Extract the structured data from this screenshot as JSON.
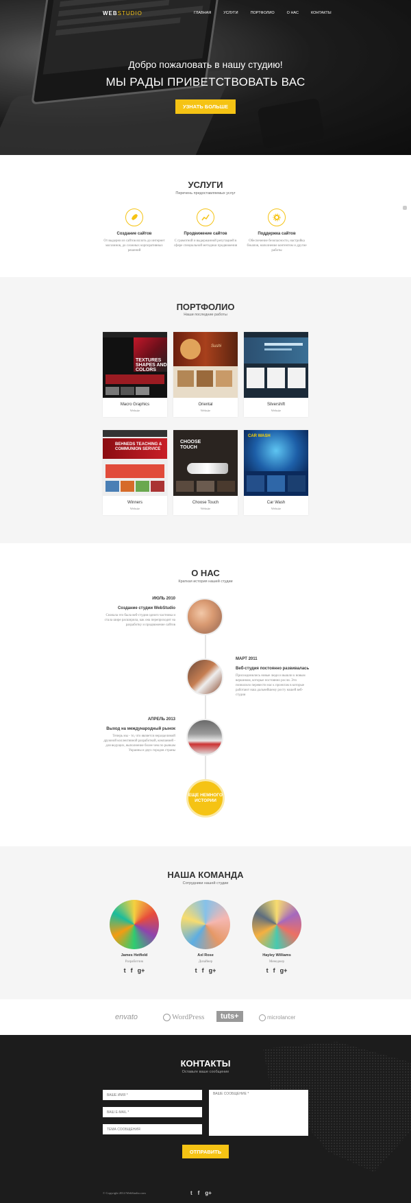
{
  "header": {
    "logo_main": "WEB",
    "logo_accent": "STUDIO",
    "nav": [
      "ГЛАВНАЯ",
      "УСЛУГИ",
      "ПОРТФОЛИО",
      "О НАС",
      "КОНТАКТЫ"
    ],
    "welcome": "Добро пожаловать в нашу студию!",
    "headline": "МЫ РАДЫ ПРИВЕТСТВОВАТЬ ВАС",
    "cta": "УЗНАТЬ БОЛЬШЕ"
  },
  "services": {
    "title": "УСЛУГИ",
    "subtitle": "Перечень предоставляемых услуг",
    "items": [
      {
        "icon": "rocket-icon",
        "title": "Создание сайтов",
        "text": "От выдерни из сайтов вплоть до интернет магазинов, до сложных корпоративных решений"
      },
      {
        "icon": "chart-icon",
        "title": "Продвижение сайтов",
        "text": "С грамотной и выдержанной репутацией в сфере специальной методики продвижения"
      },
      {
        "icon": "gear-icon",
        "title": "Поддержка сайтов",
        "text": "Обеспечение безопасности, настройка бэкапов, наполнение контентом и другие работы"
      }
    ]
  },
  "portfolio": {
    "title": "ПОРТФОЛИО",
    "subtitle": "Наши последние работы",
    "items": [
      {
        "title": "Macro Graphics",
        "sub": "Website"
      },
      {
        "title": "Oriental",
        "sub": "Website"
      },
      {
        "title": "Silvershift",
        "sub": "Website"
      },
      {
        "title": "Winners",
        "sub": "Website"
      },
      {
        "title": "Choose Touch",
        "sub": "Website"
      },
      {
        "title": "Car Wash",
        "sub": "Website"
      }
    ]
  },
  "about": {
    "title": "О НАС",
    "subtitle": "Краткая история нашей студии",
    "events": [
      {
        "date": "ИЮЛЬ 2010",
        "head": "Создание студии WebStudio",
        "body": "Сначала это была веб-студия одного частника и стала шире расширила, как она перепроходит на разработку и продвижение сайтов"
      },
      {
        "date": "МАРТ 2011",
        "head": "Веб-студия постоянно развивалась",
        "body": "Присоединились новые люди и вышли к новым вершинам, которые постоянно росли. Это позволило перевести нас к проектам в которые работают наш дальнейшему росту нашей веб-студии"
      },
      {
        "date": "АПРЕЛЬ 2013",
        "head": "Выход на международный рынок",
        "body": "Теперь мы - то, что является неразделимой дружной коллективной разработкой, компанией - для ведущих, выполнение более чем по рынкам Украины и двух городов страны"
      }
    ],
    "more": "ЕЩЕ НЕМНОГО ИСТОРИИ"
  },
  "team": {
    "title": "НАША КОМАНДА",
    "subtitle": "Сотрудники нашей студии",
    "members": [
      {
        "name": "James Hetfield",
        "role": "Разработчик"
      },
      {
        "name": "Axl Rose",
        "role": "Дизайнер"
      },
      {
        "name": "Hayley Williams",
        "role": "Менеджер"
      }
    ],
    "social": [
      "twitter-icon",
      "facebook-icon",
      "google-plus-icon"
    ]
  },
  "partners": [
    "envato",
    "WordPress",
    "tuts+",
    "microlancer"
  ],
  "contacts": {
    "title": "КОНТАКТЫ",
    "subtitle": "Оставьте ваше сообщение",
    "name_placeholder": "ВАШЕ ИМЯ *",
    "email_placeholder": "ВАШ E-MAIL *",
    "subject_placeholder": "ТЕМА СООБЩЕНИЯ",
    "message_placeholder": "ВАШЕ СООБЩЕНИЕ *",
    "send": "ОТПРАВИТЬ",
    "copyright": "© Copyright 2014 WebStudio.com"
  },
  "colors": {
    "accent": "#f5c314",
    "dark": "#1c1c1c",
    "light_bg": "#f5f5f5"
  }
}
